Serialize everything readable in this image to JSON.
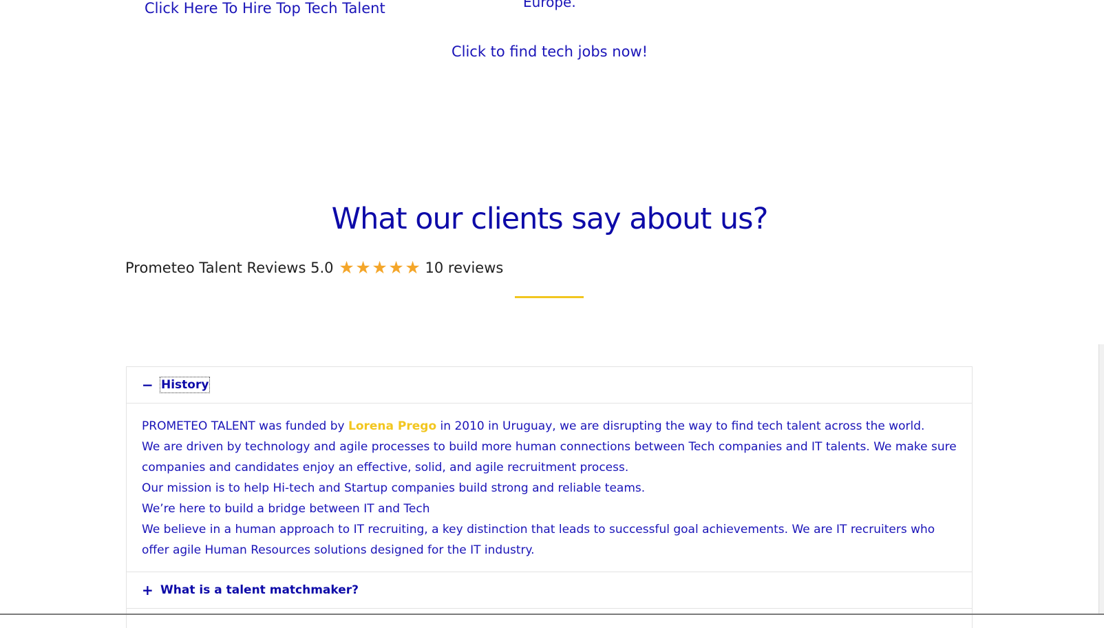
{
  "top": {
    "hire_link": "Click Here To Hire Top Tech Talent",
    "europe_text": "Europe.",
    "jobs_link": "Click to find tech jobs now!"
  },
  "reviews": {
    "title": "What our clients say about us?",
    "label": "Prometeo Talent Reviews",
    "rating": "5.0",
    "stars": 5,
    "count_text": "10 reviews",
    "star_color": "#f4a62a"
  },
  "accordion": {
    "items": [
      {
        "title": "History",
        "icon": "minus-icon",
        "expanded": true,
        "paragraphs": {
          "p1_before": "PROMETEO TALENT was funded by ",
          "p1_highlight": "Lorena Prego",
          "p1_after": " in 2010 in Uruguay, we are disrupting the way to find tech talent across the world.",
          "p2": "We are driven by technology and agile processes to build more human connections between Tech companies and IT talents. We make sure companies and candidates enjoy an effective, solid, and agile recruitment process.",
          "p3": "Our mission is to help Hi-tech and Startup companies build strong and reliable teams.",
          "p4": "We’re here to build a bridge between IT and Tech",
          "p5": "We believe in a human approach to IT recruiting, a key distinction that leads to successful goal achievements. We are IT recruiters who offer agile Human Resources solutions designed for the IT industry."
        }
      },
      {
        "title": "What is a talent matchmaker?",
        "icon": "plus-icon",
        "expanded": false
      }
    ]
  },
  "colors": {
    "brand_blue": "#1a14b8",
    "accent_yellow": "#f2c61f"
  }
}
